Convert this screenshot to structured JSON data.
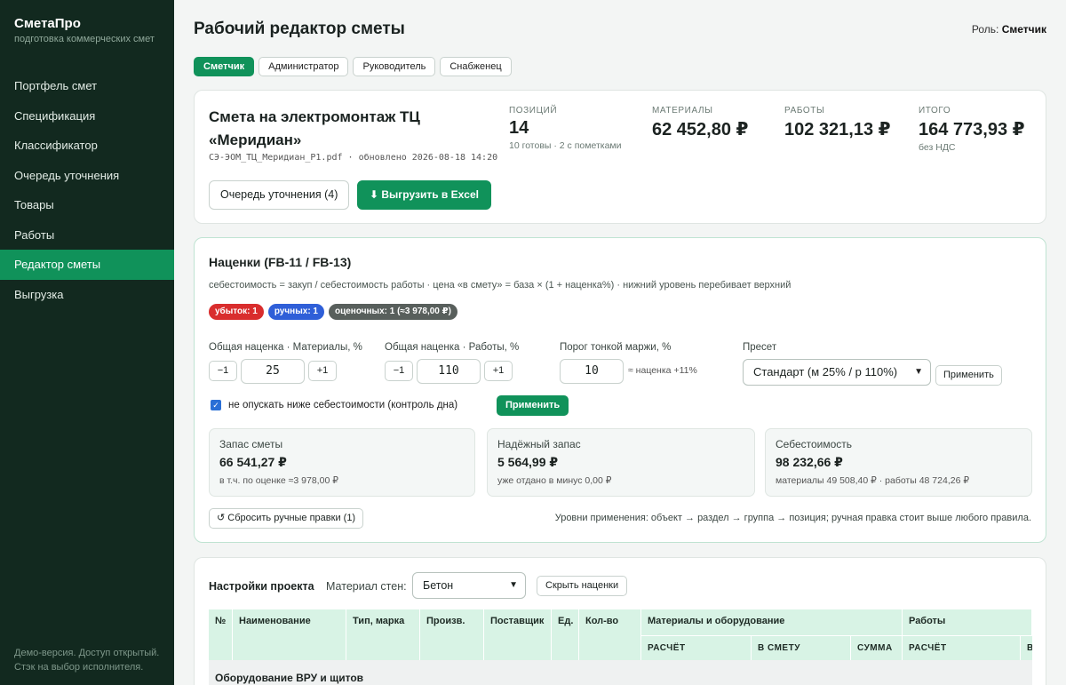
{
  "sidebar": {
    "brand_title": "СметаПро",
    "brand_sub": "подготовка коммерческих смет",
    "items": [
      {
        "label": "Портфель смет",
        "active": false
      },
      {
        "label": "Спецификация",
        "active": false
      },
      {
        "label": "Классификатор",
        "active": false
      },
      {
        "label": "Очередь уточнения",
        "active": false
      },
      {
        "label": "Товары",
        "active": false
      },
      {
        "label": "Работы",
        "active": false
      },
      {
        "label": "Редактор сметы",
        "active": true
      },
      {
        "label": "Выгрузка",
        "active": false
      }
    ],
    "footer_line1": "Демо-версия. Доступ открытый.",
    "footer_line2": "Стэк на выбор исполнителя."
  },
  "header": {
    "title": "Рабочий редактор сметы",
    "role_label": "Роль:",
    "role_value": "Сметчик"
  },
  "role_tabs": [
    {
      "label": "Сметчик",
      "active": true
    },
    {
      "label": "Администратор",
      "active": false
    },
    {
      "label": "Руководитель",
      "active": false
    },
    {
      "label": "Снабженец",
      "active": false
    }
  ],
  "estimate": {
    "title": "Смета на электромонтаж ТЦ «Меридиан»",
    "file_info": "СЭ-ЭОМ_ТЦ_Меридиан_Р1.pdf · обновлено 2026-08-18 14:20",
    "stats": {
      "positions": {
        "label": "Позиций",
        "value": "14",
        "sub": "10 готовы · 2 с пометками"
      },
      "materials": {
        "label": "Материалы",
        "value": "62 452,80 ₽"
      },
      "works": {
        "label": "Работы",
        "value": "102 321,13 ₽"
      },
      "total": {
        "label": "Итого",
        "value": "164 773,93 ₽",
        "sub": "без НДС"
      }
    },
    "queue_button": "Очередь уточнения (4)",
    "export_button": "⬇ Выгрузить в Excel"
  },
  "markup": {
    "title": "Наценки (FB-11 / FB-13)",
    "description": "себестоимость = закуп / себестоимость работы · цена «в смету» = база × (1 + наценка%) · нижний уровень перебивает верхний",
    "badges": {
      "loss": "убыток: 1",
      "manual": "ручных: 1",
      "estimated": "оценочных: 1 (≈3 978,00 ₽)"
    },
    "materials_label": "Общая наценка · Материалы, %",
    "materials_value": "25",
    "works_label": "Общая наценка · Работы, %",
    "works_value": "110",
    "threshold_label": "Порог тонкой маржи, %",
    "threshold_value": "10",
    "threshold_approx": "≈ наценка +11%",
    "preset_label": "Пресет",
    "preset_value": "Стандарт (м 25% / р 110%)",
    "minus": "−1",
    "plus": "+1",
    "apply_preset": "Применить",
    "floor_checkbox_label": "не опускать ниже себестоимости (контроль дна)",
    "floor_checked": true,
    "apply": "Применить",
    "boxes": {
      "reserve": {
        "title": "Запас сметы",
        "value": "66 541,27 ₽",
        "sub": "в т.ч. по оценке ≈3 978,00 ₽"
      },
      "reliable": {
        "title": "Надёжный запас",
        "value": "5 564,99 ₽",
        "sub": "уже отдано в минус 0,00 ₽"
      },
      "cost": {
        "title": "Себестоимость",
        "value": "98 232,66 ₽",
        "sub": "материалы 49 508,40 ₽ · работы 48 724,26 ₽"
      }
    },
    "reset_button": "↺ Сбросить ручные правки (1)",
    "levels_note": "Уровни применения: объект → раздел → группа → позиция; ручная правка стоит выше любого правила."
  },
  "project_settings": {
    "title": "Настройки проекта",
    "wall_label": "Материал стен:",
    "wall_value": "Бетон",
    "hide_markups": "Скрыть наценки"
  },
  "table": {
    "headers": {
      "num": "№",
      "name": "Наименование",
      "type": "Тип, марка",
      "mfr": "Произв.",
      "supplier": "Поставщик",
      "unit": "Ед.",
      "qty": "Кол-во",
      "materials": "Материалы и оборудование",
      "works": "Работы"
    },
    "subheaders": {
      "m_calc": "РАСЧЁТ",
      "m_est": "В СМЕТУ",
      "m_sum": "СУММА",
      "w_calc": "РАСЧЁТ",
      "w_est": "В"
    },
    "group_title": "Оборудование ВРУ и щитов"
  },
  "colors": {
    "accent": "#10925a",
    "sidebar_bg": "#12291f",
    "loss": "#d92d2d",
    "manual": "#2f5fd8",
    "table_header": "#d8f3e5"
  }
}
